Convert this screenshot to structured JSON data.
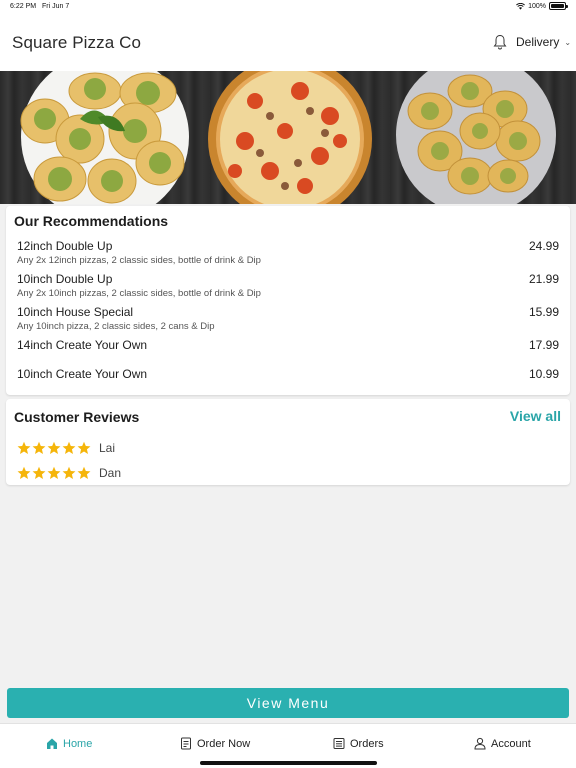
{
  "status_bar": {
    "time": "6:22 PM",
    "date": "Fri Jun 7",
    "battery": "100%"
  },
  "header": {
    "title": "Square Pizza Co",
    "delivery_label": "Delivery"
  },
  "recommendations": {
    "title": "Our Recommendations",
    "items": [
      {
        "name": "12inch Double Up",
        "desc": "Any 2x 12inch pizzas, 2 classic sides, bottle of drink & Dip",
        "price": "24.99"
      },
      {
        "name": "10inch Double Up",
        "desc": "Any 2x 10inch pizzas, 2 classic sides, bottle of drink & Dip",
        "price": "21.99"
      },
      {
        "name": "10inch House Special",
        "desc": "Any 10inch pizza, 2 classic sides, 2 cans & Dip",
        "price": "15.99"
      },
      {
        "name": "14inch Create Your Own",
        "desc": "",
        "price": "17.99"
      },
      {
        "name": "10inch Create Your Own",
        "desc": "",
        "price": "10.99"
      }
    ]
  },
  "reviews": {
    "title": "Customer Reviews",
    "view_all": "View all",
    "items": [
      {
        "name": "Lai",
        "rating": 5
      },
      {
        "name": "Dan",
        "rating": 5
      }
    ]
  },
  "view_menu_label": "View Menu",
  "tabs": [
    {
      "label": "Home",
      "icon": "home-icon",
      "active": true
    },
    {
      "label": "Order Now",
      "icon": "order-icon",
      "active": false
    },
    {
      "label": "Orders",
      "icon": "orders-icon",
      "active": false
    },
    {
      "label": "Account",
      "icon": "account-icon",
      "active": false
    }
  ],
  "colors": {
    "accent": "#2ab0b0",
    "link": "#2aa5a8",
    "star": "#f5b50a"
  }
}
